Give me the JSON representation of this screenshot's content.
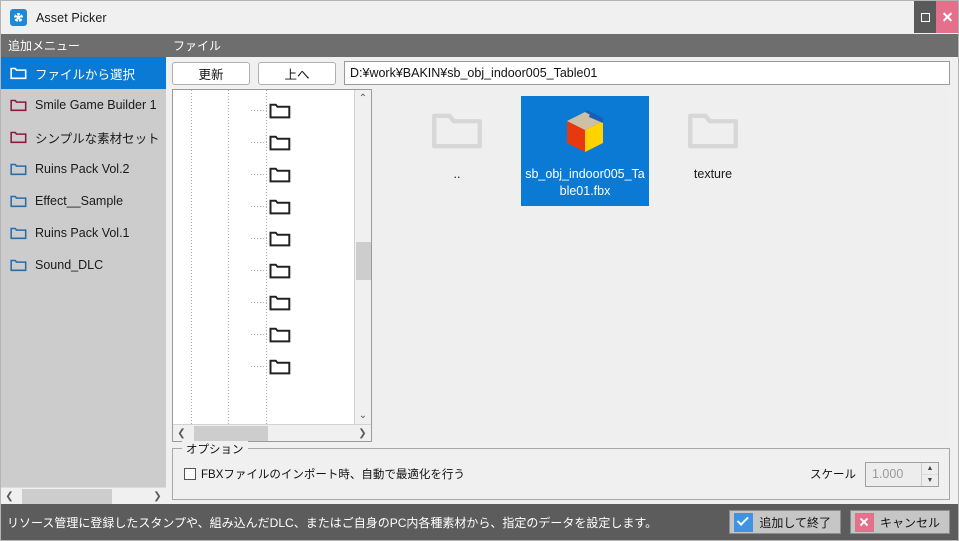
{
  "window": {
    "title": "Asset Picker",
    "app_icon": "asset-picker-icon",
    "maximize_icon": "maximize-icon",
    "close_icon": "close-icon"
  },
  "sidebar": {
    "header": "追加メニュー",
    "items": [
      {
        "label": "ファイルから選択",
        "icon": "folder-icon",
        "icon_color": "#ffffff",
        "selected": true
      },
      {
        "label": "Smile Game Builder 1",
        "icon": "folder-icon",
        "icon_color": "#8b1a3c",
        "selected": false
      },
      {
        "label": "シンプルな素材セット",
        "icon": "folder-icon",
        "icon_color": "#8b1a3c",
        "selected": false
      },
      {
        "label": "Ruins Pack Vol.2",
        "icon": "folder-icon",
        "icon_color": "#2b6ca3",
        "selected": false
      },
      {
        "label": "Effect__Sample",
        "icon": "folder-icon",
        "icon_color": "#2b6ca3",
        "selected": false
      },
      {
        "label": "Ruins Pack Vol.1",
        "icon": "folder-icon",
        "icon_color": "#2b6ca3",
        "selected": false
      },
      {
        "label": "Sound_DLC",
        "icon": "folder-icon",
        "icon_color": "#2b6ca3",
        "selected": false
      }
    ],
    "scroll_left_icon": "chevron-left-icon",
    "scroll_right_icon": "chevron-right-icon"
  },
  "file_panel": {
    "header": "ファイル",
    "refresh_label": "更新",
    "up_label": "上へ",
    "path_value": "D:¥work¥BAKIN¥sb_obj_indoor005_Table01",
    "tree": {
      "node_count": 9,
      "node_icon": "folder-icon",
      "scroll_up_icon": "chevron-up-icon",
      "scroll_down_icon": "chevron-down-icon",
      "scroll_left_icon": "chevron-left-icon",
      "scroll_right_icon": "chevron-right-icon"
    },
    "files": [
      {
        "name": "..",
        "icon": "folder-icon",
        "selected": false
      },
      {
        "name": "sb_obj_indoor005_Table01.fbx",
        "icon": "fbx-model-icon",
        "selected": true
      },
      {
        "name": "texture",
        "icon": "folder-icon",
        "selected": false
      }
    ]
  },
  "options": {
    "legend": "オプション",
    "optimize_checkbox_label": "FBXファイルのインポート時、自動で最適化を行う",
    "optimize_checked": false,
    "scale_label": "スケール",
    "scale_value": "1.000",
    "scale_enabled": false,
    "spin_up_icon": "caret-up-icon",
    "spin_down_icon": "caret-down-icon"
  },
  "statusbar": {
    "message": "リソース管理に登録したスタンプや、組み込んだDLC、またはご自身のPC内各種素材から、指定のデータを設定します。",
    "confirm_label": "追加して終了",
    "confirm_icon": "check-icon",
    "cancel_label": "キャンセル",
    "cancel_icon": "x-icon"
  },
  "colors": {
    "accent_blue": "#0a7ad4",
    "panel_header": "#6e6e6e",
    "statusbar_bg": "#5c5c5c",
    "close_pink": "#e4708b",
    "sidebar_bg": "#cccccc"
  }
}
